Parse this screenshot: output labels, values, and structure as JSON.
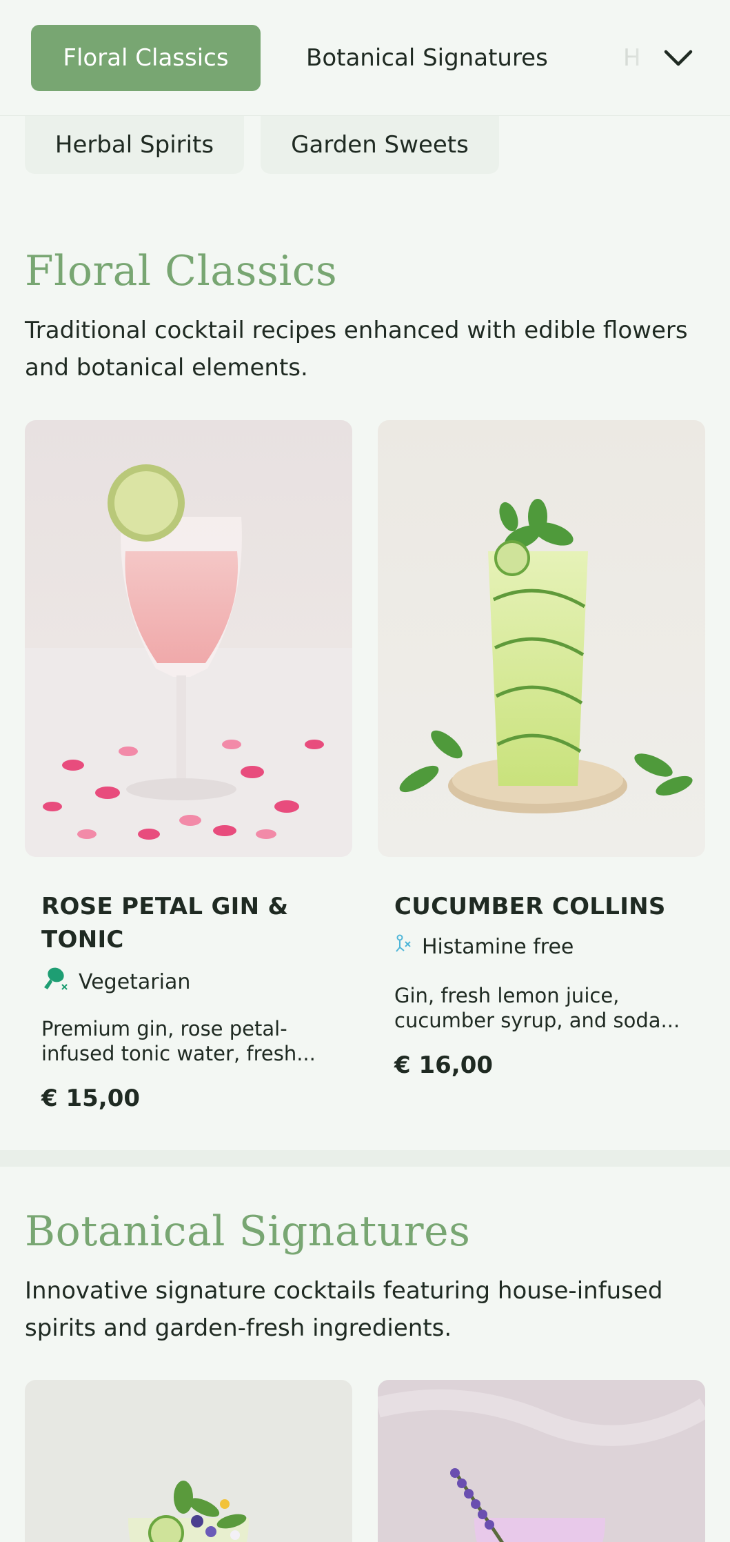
{
  "nav": {
    "tabs": [
      {
        "label": "Floral Classics",
        "active": true
      },
      {
        "label": "Botanical Signatures",
        "active": false
      },
      {
        "label": "H",
        "active": false
      }
    ],
    "chips": [
      {
        "label": "Herbal Spirits"
      },
      {
        "label": "Garden Sweets"
      }
    ],
    "expand_icon": "chevron-down-icon"
  },
  "sections": [
    {
      "title": "Floral Classics",
      "description": "Traditional cocktail recipes enhanced with edible flowers and botanical elements.",
      "items": [
        {
          "name_line1": "ROSE PETAL GIN &",
          "name_line2": "TONIC",
          "tag": "Vegetarian",
          "tag_icon": "vegetarian-drumstick-icon",
          "description_line1": "Premium gin, rose petal-",
          "description_line2": "infused tonic water, fresh...",
          "price": "€ 15,00"
        },
        {
          "name_line1": "CUCUMBER COLLINS",
          "tag": "Histamine free",
          "tag_icon": "histamine-free-icon",
          "description_line1": "Gin, fresh lemon juice,",
          "description_line2": "cucumber syrup, and soda...",
          "price": "€ 16,00"
        }
      ]
    },
    {
      "title": "Botanical Signatures",
      "description": "Innovative signature cocktails featuring house-infused spirits and garden-fresh ingredients."
    }
  ],
  "colors": {
    "accent": "#78a672",
    "background": "#f3f7f3",
    "text": "#1f2a22",
    "vegetarian_icon": "#1e9e73",
    "histamine_icon": "#4fb6d8"
  }
}
